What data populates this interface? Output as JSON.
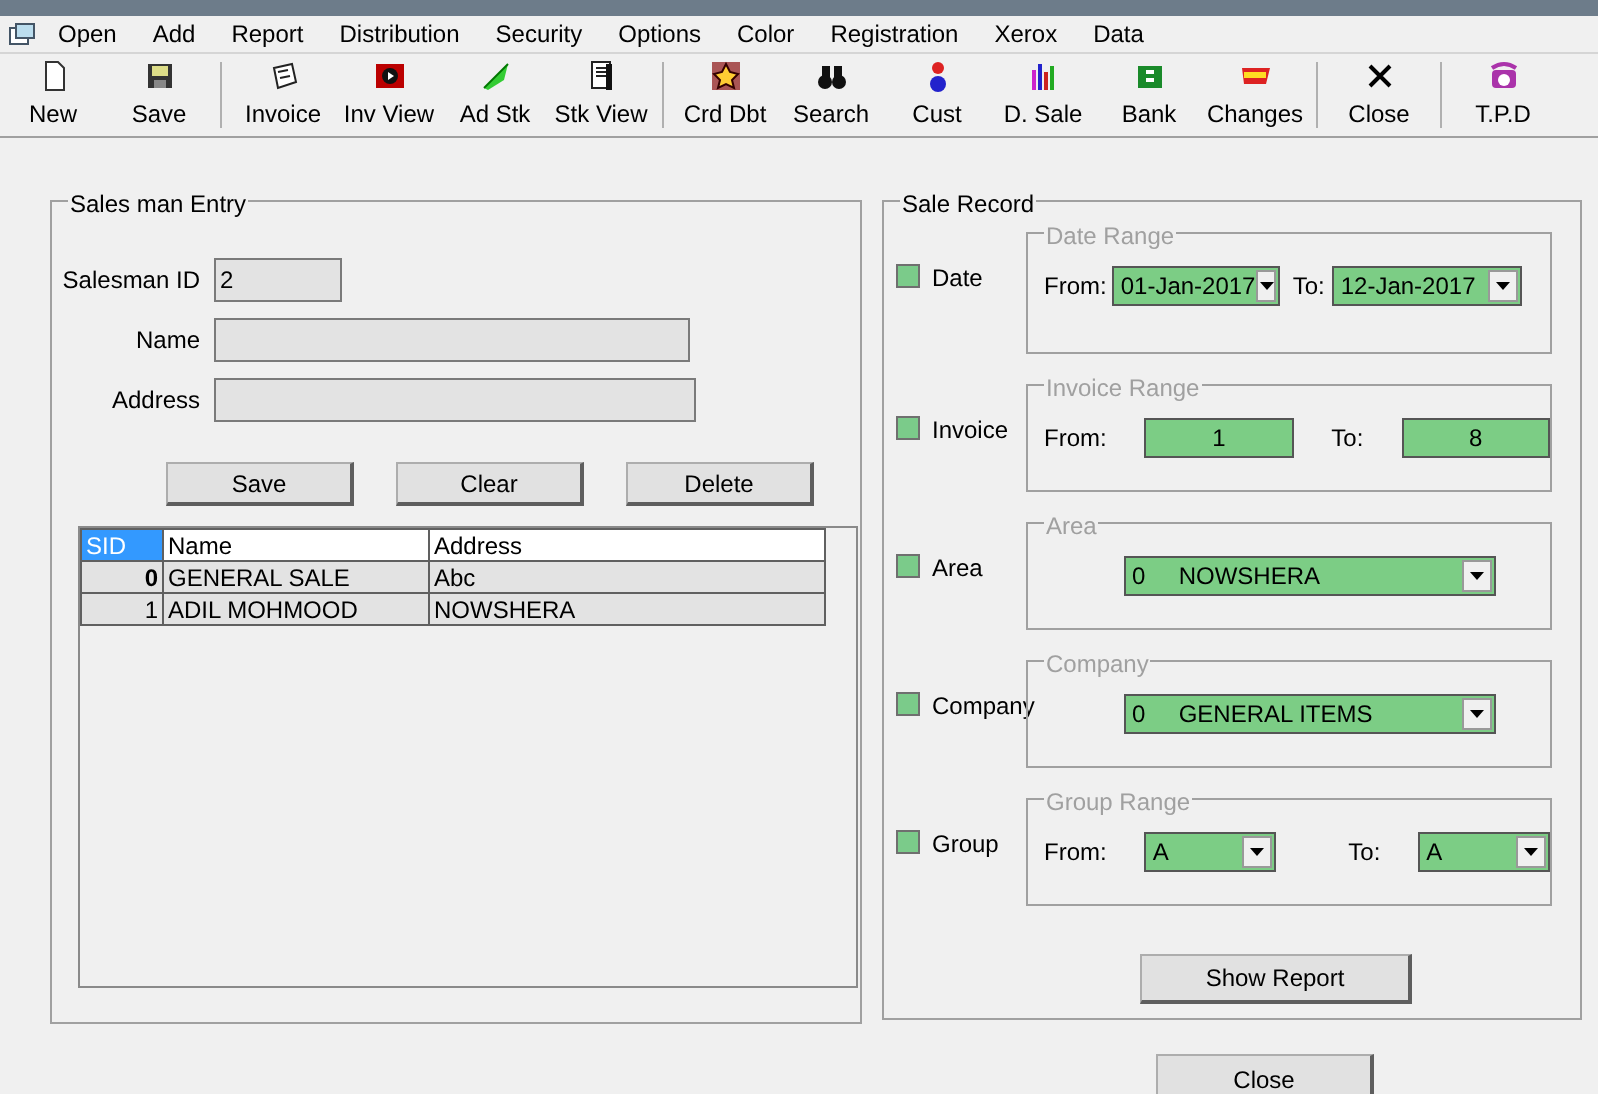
{
  "menu": [
    "Open",
    "Add",
    "Report",
    "Distribution",
    "Security",
    "Options",
    "Color",
    "Registration",
    "Xerox",
    "Data"
  ],
  "toolbar": [
    [
      "New",
      "Save"
    ],
    [
      "Invoice",
      "Inv View",
      "Ad Stk",
      "Stk View"
    ],
    [
      "Crd Dbt",
      "Search",
      "Cust",
      "D. Sale",
      "Bank",
      "Changes"
    ],
    [
      "Close"
    ],
    [
      "T.P.D"
    ]
  ],
  "salesman_entry": {
    "title": "Sales man Entry",
    "fields": [
      {
        "label": "Salesman ID",
        "value": "2"
      },
      {
        "label": "Name"
      },
      {
        "label": "Address"
      }
    ],
    "buttons": [
      "Save",
      "Clear",
      "Delete"
    ],
    "table": {
      "columns": [
        "SID",
        "Name",
        "Address"
      ],
      "rows": [
        [
          "0",
          "GENERAL SALE",
          "Abc"
        ],
        [
          "1",
          "ADIL MOHMOOD",
          "NOWSHERA"
        ]
      ]
    }
  },
  "sale_record": {
    "title": "Sale Record",
    "filters": [
      {
        "label": "Date",
        "checked": false,
        "group": "Date Range",
        "kind": "daterange",
        "from_label": "From:",
        "from": "01-Jan-2017",
        "to_label": "To:",
        "to": "12-Jan-2017"
      },
      {
        "label": "Invoice",
        "checked": false,
        "group": "Invoice Range",
        "kind": "textrange",
        "from_label": "From:",
        "from": "1",
        "to_label": "To:",
        "to": "8"
      },
      {
        "label": "Area",
        "checked": false,
        "group": "Area",
        "kind": "single",
        "value": "0     NOWSHERA"
      },
      {
        "label": "Company",
        "checked": false,
        "group": "Company",
        "kind": "single",
        "value": "0     GENERAL ITEMS"
      },
      {
        "label": "Group",
        "checked": false,
        "group": "Group Range",
        "kind": "listrange",
        "from_label": "From:",
        "from": "A",
        "to_label": "To:",
        "to": "A"
      }
    ],
    "button": "Show Report"
  },
  "close_button": "Close"
}
